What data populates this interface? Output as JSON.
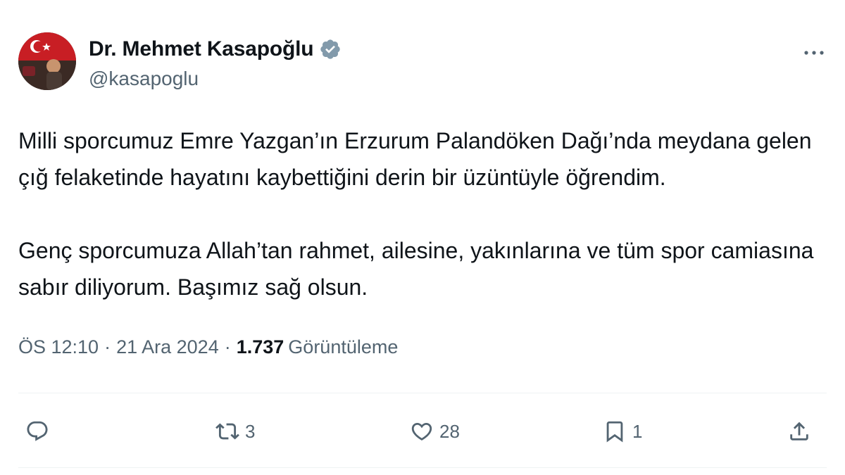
{
  "author": {
    "display_name": "Dr. Mehmet Kasapoğlu",
    "handle": "@kasapoglu",
    "verified": true
  },
  "tweet": {
    "paragraphs": [
      "Milli sporcumuz Emre Yazgan’ın Erzurum Palandöken Dağı’nda meydana gelen çığ felaketinde hayatını kaybettiğini derin bir üzüntüyle öğrendim.",
      "Genç sporcumuza Allah’tan rahmet, ailesine, yakınlarına ve tüm spor camiasına sabır diliyorum. Başımız sağ olsun."
    ],
    "time": "ÖS 12:10",
    "separator": "·",
    "date": "21 Ara 2024",
    "views_count": "1.737",
    "views_label": "Görüntüleme"
  },
  "actions": {
    "reply_count": "",
    "retweet_count": "3",
    "like_count": "28",
    "bookmark_count": "1"
  },
  "icons": {
    "verified": "verified-badge-icon",
    "more": "more-dots-icon",
    "reply": "reply-bubble-icon",
    "retweet": "retweet-icon",
    "like": "heart-icon",
    "bookmark": "bookmark-icon",
    "share": "share-icon"
  },
  "colors": {
    "text_primary": "#0f1419",
    "text_secondary": "#536471",
    "divider": "#eff3f4",
    "verified_badge": "#829aab"
  }
}
